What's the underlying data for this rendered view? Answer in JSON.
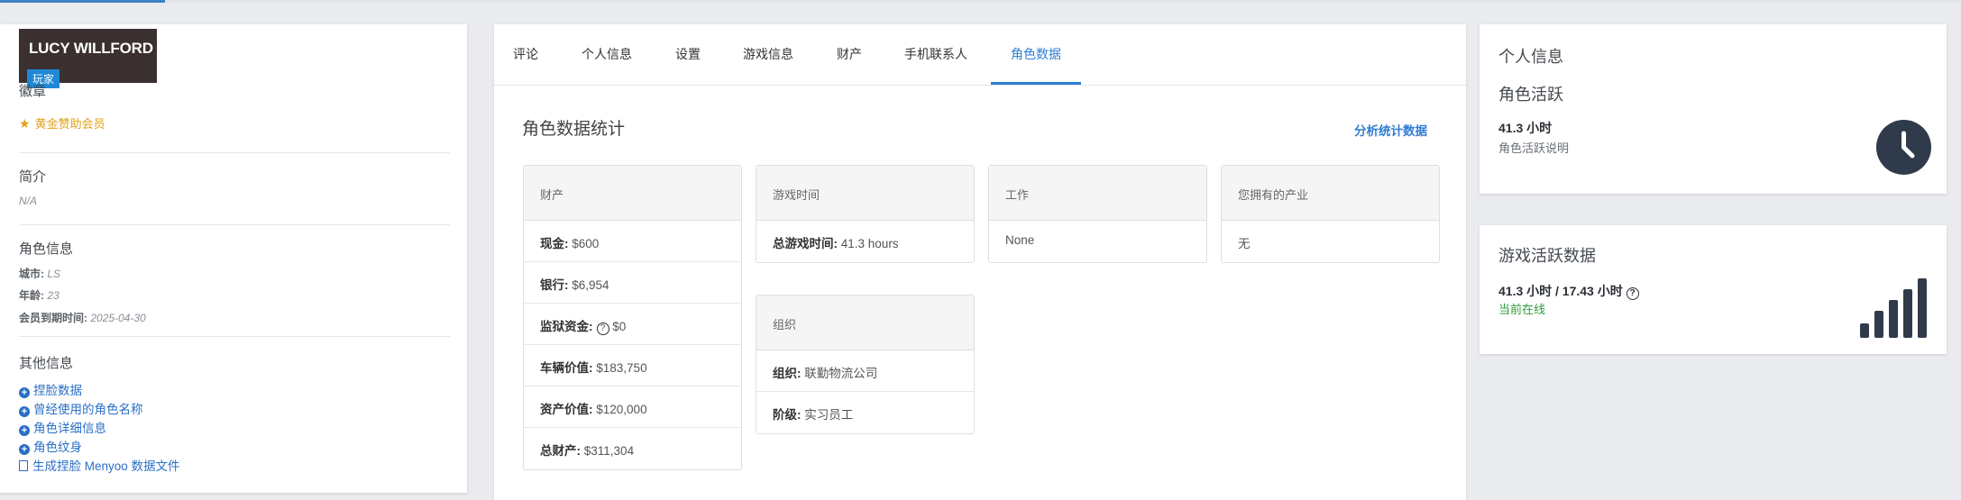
{
  "profile": {
    "name": "LUCY WILLFORD",
    "role_badge": "玩家",
    "badges_title": "徽章",
    "badge_member": "黄金赞助会员",
    "intro_title": "简介",
    "intro_value": "N/A",
    "char_info_title": "角色信息",
    "city_label": "城市:",
    "city_value": "LS",
    "age_label": "年龄:",
    "age_value": "23",
    "expire_label": "会员到期时间:",
    "expire_value": "2025-04-30",
    "other_title": "其他信息",
    "links": [
      "捏脸数据",
      "曾经使用的角色名称",
      "角色详细信息",
      "角色纹身",
      "生成捏脸 Menyoo 数据文件"
    ]
  },
  "tabs": [
    {
      "label": "评论",
      "active": false
    },
    {
      "label": "个人信息",
      "active": false
    },
    {
      "label": "设置",
      "active": false
    },
    {
      "label": "游戏信息",
      "active": false
    },
    {
      "label": "财产",
      "active": false
    },
    {
      "label": "手机联系人",
      "active": false
    },
    {
      "label": "角色数据",
      "active": true
    }
  ],
  "stats": {
    "title": "角色数据统计",
    "analyze_link": "分析统计数据",
    "finance": {
      "header": "财产",
      "rows": [
        {
          "label": "现金:",
          "value": "$600"
        },
        {
          "label": "银行:",
          "value": "$6,954"
        },
        {
          "label": "监狱资金:",
          "value": "$0"
        },
        {
          "label": "车辆价值:",
          "value": "$183,750"
        },
        {
          "label": "资产价值:",
          "value": "$120,000"
        },
        {
          "label": "总财产:",
          "value": "$311,304"
        }
      ]
    },
    "playtime": {
      "header": "游戏时间",
      "label": "总游戏时间:",
      "value": "41.3 hours"
    },
    "job": {
      "header": "工作",
      "value": "None"
    },
    "business": {
      "header": "您拥有的产业",
      "value": "无"
    },
    "org": {
      "header": "组织",
      "rows": [
        {
          "label": "组织:",
          "value": "联勤物流公司"
        },
        {
          "label": "阶级:",
          "value": "实习员工"
        }
      ]
    }
  },
  "right": {
    "info_title": "个人信息",
    "active_title": "角色活跃",
    "active_hours": "41.3 小时",
    "active_desc": "角色活跃说明",
    "clock_icon": "clock-icon",
    "game_title": "游戏活跃数据",
    "game_hours": "41.3 小时 / 17.43 小时",
    "online": "当前在线",
    "signal_icon": "signal-bars-icon"
  },
  "colors": {
    "accent": "#2f7dd4",
    "gold": "#e0a21a",
    "online": "#2e9b3a",
    "dark": "#2f3b4a"
  }
}
